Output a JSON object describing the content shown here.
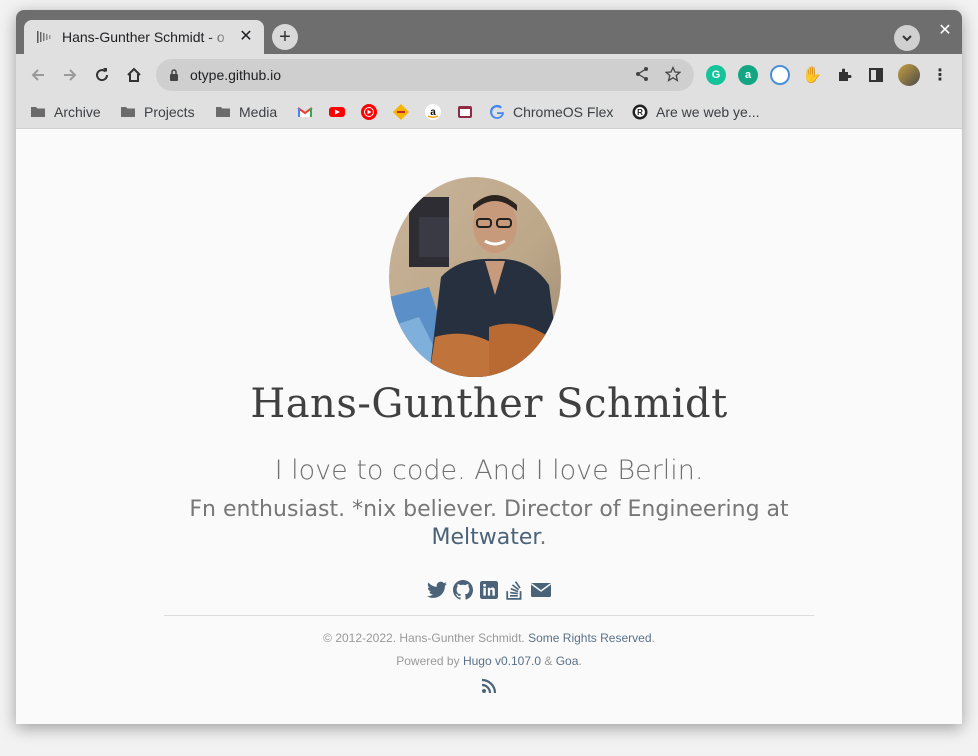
{
  "browser": {
    "tab": {
      "title": "Hans-Gunther Schmidt - o",
      "close": "✕"
    },
    "newtab": "+",
    "window_close": "✕",
    "url": "otype.github.io"
  },
  "bookmarks": [
    {
      "label": "Archive",
      "icon": "folder-icon"
    },
    {
      "label": "Projects",
      "icon": "folder-icon"
    },
    {
      "label": "Media",
      "icon": "folder-icon"
    },
    {
      "label": "ChromeOS Flex",
      "icon": "google-icon"
    },
    {
      "label": "Are we web ye...",
      "icon": "rust-icon"
    }
  ],
  "page": {
    "name": "Hans-Gunther Schmidt",
    "tagline": "I love to code. And I love Berlin.",
    "bio_text": "Fn enthusiast. *nix believer. Director of Engineering at",
    "bio_link": "Meltwater",
    "bio_end": ".",
    "footer": {
      "copyright": "© 2012-2022. Hans-Gunther Schmidt.",
      "rights_link": "Some Rights Reserved",
      "rights_end": ".",
      "powered": "Powered by",
      "hugo_link": "Hugo v0.107.0",
      "amp": "&",
      "theme_link": "Goa",
      "end": "."
    }
  },
  "colors": {
    "accent": "#4a6379",
    "tabstrip": "#6e6e6e",
    "toolbar": "#e0e0e0"
  }
}
